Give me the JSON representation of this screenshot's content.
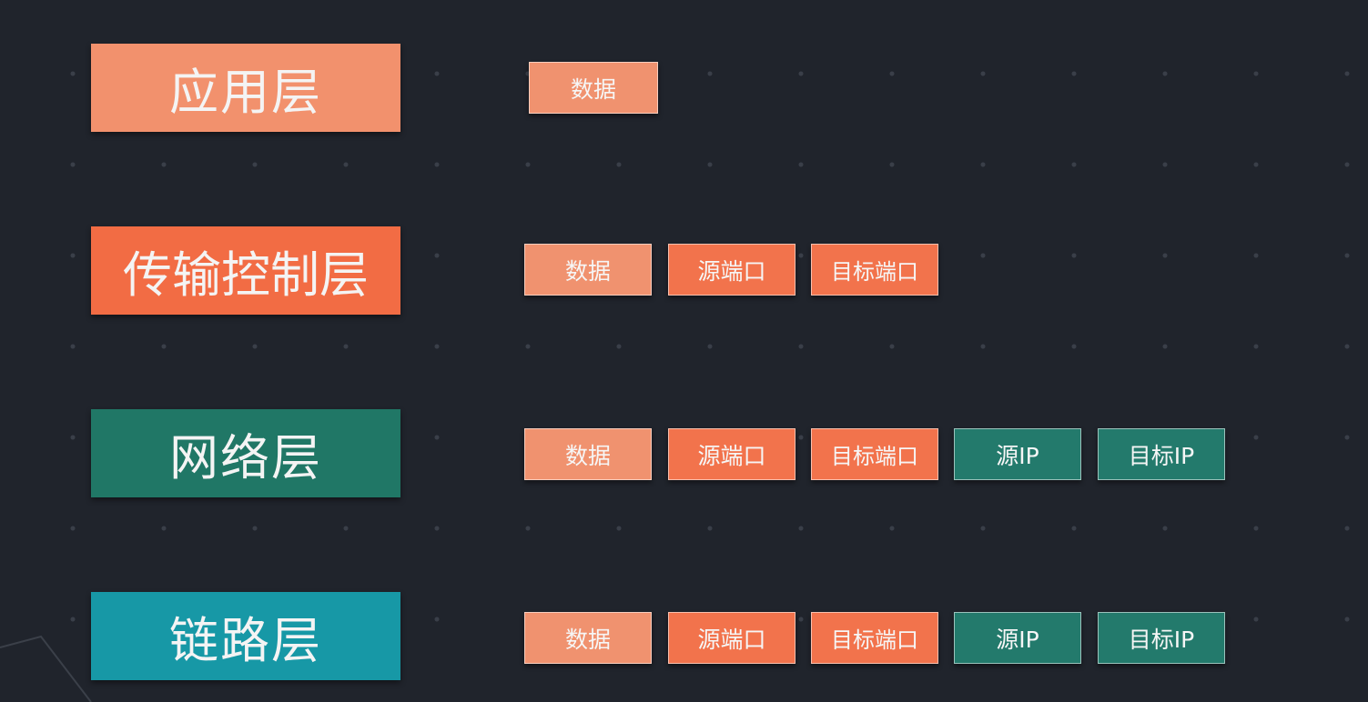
{
  "colors": {
    "background": "#20242c",
    "application": "#f2916d",
    "transport": "#f26c44",
    "network": "#207766",
    "link": "#1798a6",
    "data_cell": "#f0926f",
    "port_cell": "#f2734c",
    "ip_cell": "#237a6c"
  },
  "layers": [
    {
      "label": "应用层",
      "cells": [
        {
          "text": "数据",
          "kind": "data"
        }
      ]
    },
    {
      "label": "传输控制层",
      "cells": [
        {
          "text": "数据",
          "kind": "data"
        },
        {
          "text": "源端口",
          "kind": "port"
        },
        {
          "text": "目标端口",
          "kind": "port"
        }
      ]
    },
    {
      "label": "网络层",
      "cells": [
        {
          "text": "数据",
          "kind": "data"
        },
        {
          "text": "源端口",
          "kind": "port"
        },
        {
          "text": "目标端口",
          "kind": "port"
        },
        {
          "text": "源IP",
          "kind": "ip"
        },
        {
          "text": "目标IP",
          "kind": "ip"
        }
      ]
    },
    {
      "label": "链路层",
      "cells": [
        {
          "text": "数据",
          "kind": "data"
        },
        {
          "text": "源端口",
          "kind": "port"
        },
        {
          "text": "目标端口",
          "kind": "port"
        },
        {
          "text": "源IP",
          "kind": "ip"
        },
        {
          "text": "目标IP",
          "kind": "ip"
        }
      ]
    }
  ]
}
